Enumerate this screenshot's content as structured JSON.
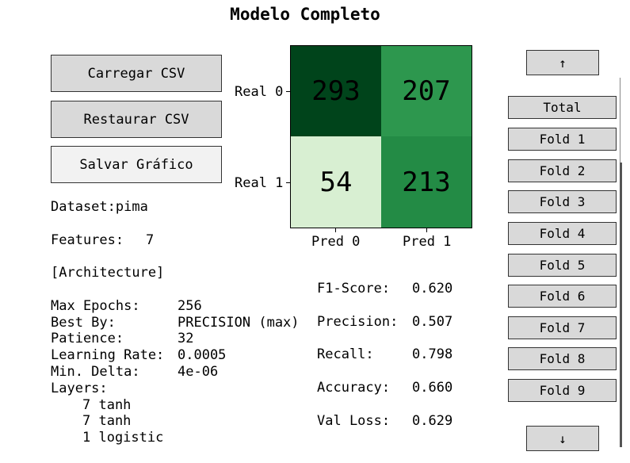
{
  "title": "Modelo Completo",
  "buttons": {
    "load_csv": "Carregar CSV",
    "restore_csv": "Restaurar CSV",
    "save_chart": "Salvar Gráfico"
  },
  "info": {
    "dataset_label": "Dataset:",
    "dataset_value": "pima",
    "features_label": "Features:",
    "features_value": "7",
    "architecture": "[Architecture]",
    "max_epochs_label": "Max Epochs:",
    "max_epochs_value": "256",
    "best_by_label": "Best By:",
    "best_by_value": "PRECISION (max)",
    "patience_label": "Patience:",
    "patience_value": "32",
    "learning_rate_label": "Learning Rate:",
    "learning_rate_value": "0.0005",
    "min_delta_label": "Min. Delta:",
    "min_delta_value": "4e-06",
    "layers_label": "Layers:",
    "layers": [
      "7 tanh",
      "7 tanh",
      "1 logistic"
    ]
  },
  "confusion_matrix": {
    "row_labels": [
      "Real 0",
      "Real 1"
    ],
    "col_labels": [
      "Pred 0",
      "Pred 1"
    ],
    "values": [
      [
        "293",
        "207"
      ],
      [
        "54",
        "213"
      ]
    ],
    "colors": [
      [
        "#00441b",
        "#2d974e"
      ],
      [
        "#d8efd2",
        "#238b45"
      ]
    ],
    "text_colors": [
      [
        "#000000",
        "#000000"
      ],
      [
        "#000000",
        "#000000"
      ]
    ]
  },
  "metrics": [
    {
      "label": "F1-Score:",
      "value": "0.620"
    },
    {
      "label": "Precision:",
      "value": "0.507"
    },
    {
      "label": "Recall:",
      "value": "0.798"
    },
    {
      "label": "Accuracy:",
      "value": "0.660"
    },
    {
      "label": "Val Loss:",
      "value": "0.629"
    }
  ],
  "fold_list": {
    "up_label": "↑",
    "down_label": "↓",
    "items": [
      "Total",
      "Fold 1",
      "Fold 2",
      "Fold 3",
      "Fold 4",
      "Fold 5",
      "Fold 6",
      "Fold 7",
      "Fold 8",
      "Fold 9"
    ]
  }
}
